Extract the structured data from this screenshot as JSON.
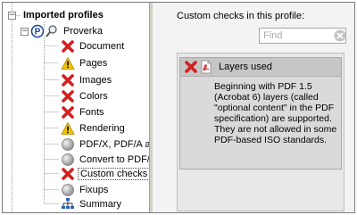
{
  "tree": {
    "root_label": "Imported profiles",
    "profile_label": "Proverka",
    "items": [
      {
        "label": "Document",
        "icon": "red-x-icon"
      },
      {
        "label": "Pages",
        "icon": "warning-icon"
      },
      {
        "label": "Images",
        "icon": "red-x-icon"
      },
      {
        "label": "Colors",
        "icon": "red-x-icon"
      },
      {
        "label": "Fonts",
        "icon": "red-x-icon"
      },
      {
        "label": "Rendering",
        "icon": "warning-icon"
      },
      {
        "label": "PDF/X, PDF/A ar",
        "icon": "gray-circle-icon"
      },
      {
        "label": "Convert to PDF/",
        "icon": "gray-circle-icon"
      },
      {
        "label": "Custom checks",
        "icon": "red-x-icon",
        "selected": true
      },
      {
        "label": "Fixups",
        "icon": "gray-circle-icon"
      },
      {
        "label": "Summary",
        "icon": "hierarchy-icon"
      }
    ]
  },
  "right": {
    "title": "Custom checks in this profile:",
    "find_placeholder": "Find",
    "check": {
      "title": "Layers used",
      "description": "Beginning with PDF 1.5 (Acrobat 6) layers (called \"optional content\" in the PDF specification) are supported. They are not allowed in some PDF-based ISO standards."
    }
  },
  "colors": {
    "error_red": "#d42020",
    "warning_yellow": "#f4c400",
    "inactive_gray": "#a8a8a8",
    "panel_bg": "#f3f3f3",
    "header_bg": "#c6c6c6"
  }
}
